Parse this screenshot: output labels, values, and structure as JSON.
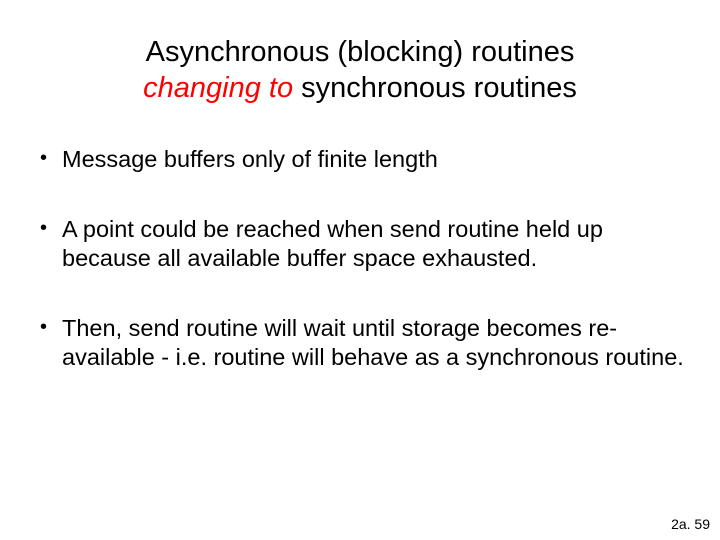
{
  "title_line1": "Asynchronous (blocking) routines",
  "title_em": "changing to",
  "title_line2_rest": " synchronous routines",
  "bullets": [
    "Message buffers only of finite length",
    "A point could be reached when send routine held up because all available buffer space exhausted.",
    "Then, send routine will wait until storage becomes re-available - i.e. routine will behave as a synchronous routine."
  ],
  "footer": "2a. 59"
}
